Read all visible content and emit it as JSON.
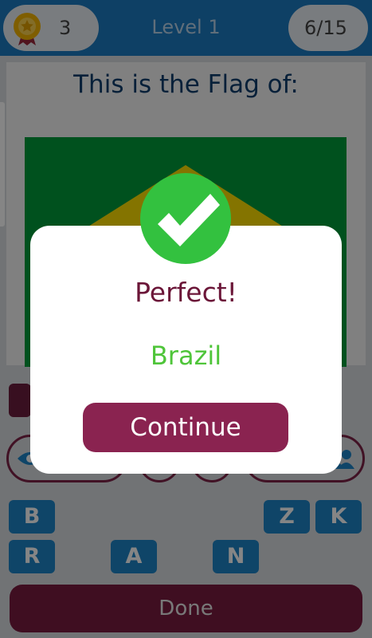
{
  "header": {
    "coins": "3",
    "level_label": "Level 1",
    "progress": "6/15"
  },
  "question": {
    "text": "This is the Flag of:"
  },
  "letters": [
    {
      "label": "B"
    },
    {
      "label": "Z"
    },
    {
      "label": "K"
    },
    {
      "label": "R"
    },
    {
      "label": "A"
    },
    {
      "label": "N"
    }
  ],
  "footer": {
    "done_label": "Done"
  },
  "dialog": {
    "title": "Perfect!",
    "answer": "Brazil",
    "continue_label": "Continue"
  },
  "icons": {
    "medal": "medal-icon",
    "check": "check-icon",
    "eye": "eye-icon",
    "people": "people-icon"
  },
  "colors": {
    "top_bar": "#1c7bc1",
    "tile": "#1d84c8",
    "primary": "#8a2350",
    "success": "#33c13f",
    "flag_green": "#009b3a",
    "flag_yellow": "#fedf00"
  }
}
